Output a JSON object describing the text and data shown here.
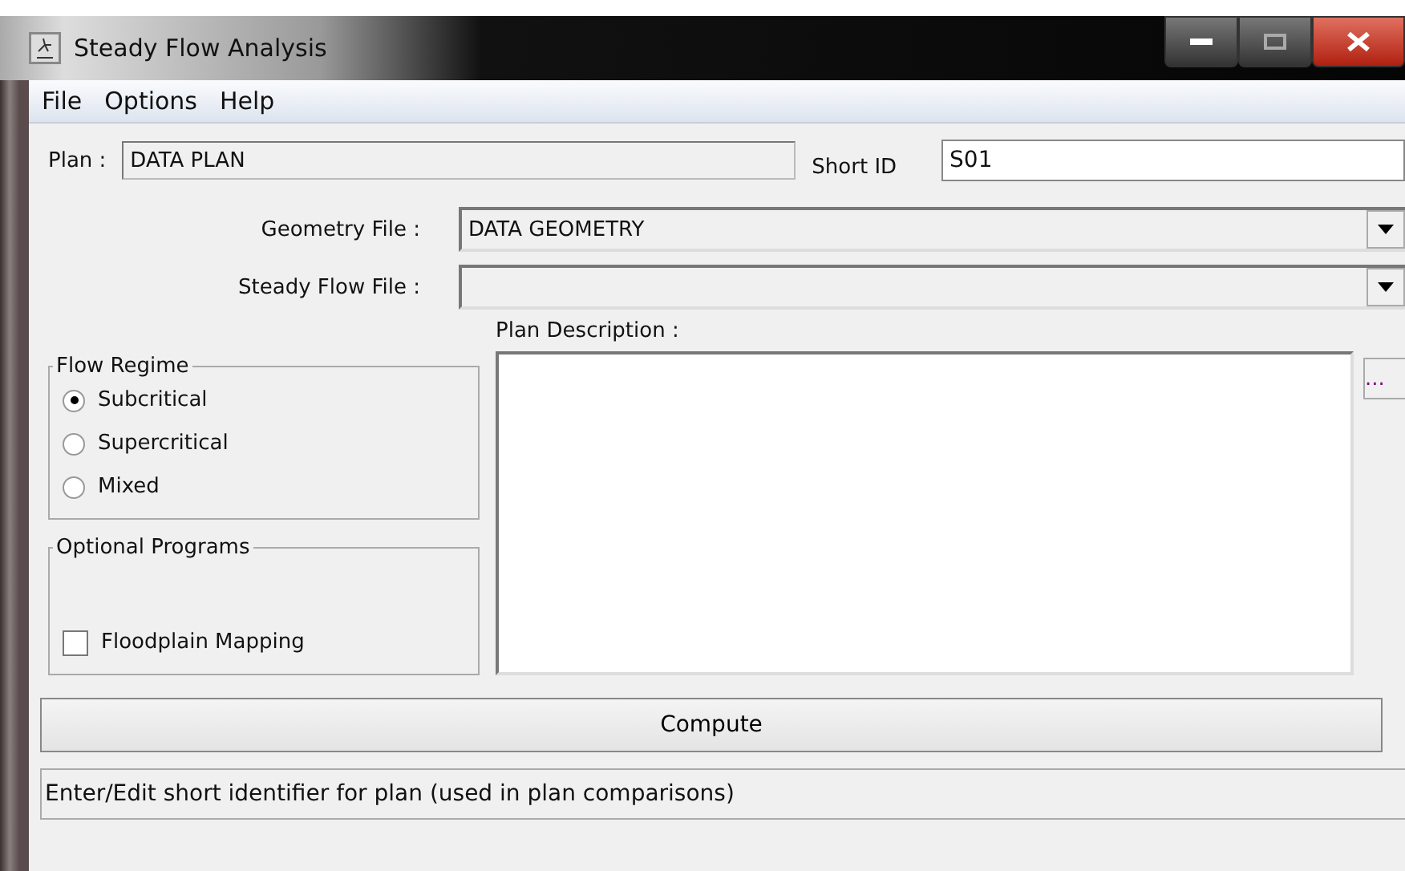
{
  "window": {
    "title": "Steady Flow Analysis"
  },
  "menu": [
    "File",
    "Options",
    "Help"
  ],
  "plan": {
    "label": "Plan :",
    "value": "DATA PLAN"
  },
  "short_id": {
    "label": "Short ID",
    "value": "S01"
  },
  "geometry_file": {
    "label": "Geometry File :",
    "value": "DATA GEOMETRY"
  },
  "steady_flow_file": {
    "label": "Steady Flow File :"
  },
  "flow_regime": {
    "title": "Flow Regime",
    "options": [
      {
        "label": "Subcritical",
        "selected": true
      },
      {
        "label": "Supercritical",
        "selected": false
      },
      {
        "label": "Mixed",
        "selected": false
      }
    ]
  },
  "optional_programs": {
    "title": "Optional Programs",
    "options": [
      {
        "label": "Floodplain Mapping",
        "checked": false
      }
    ]
  },
  "plan_description": {
    "label": "Plan Description :",
    "more_button": "..."
  },
  "compute_button": "Compute",
  "status_bar": "Enter/Edit short identifier for plan (used in plan comparisons)"
}
